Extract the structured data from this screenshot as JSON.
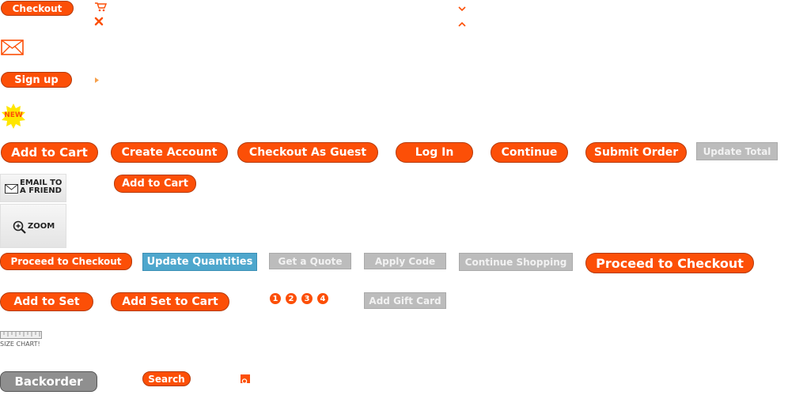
{
  "buttons": {
    "checkout_small": "Checkout",
    "sign_up": "Sign up",
    "add_to_cart": "Add to Cart",
    "create_account": "Create Account",
    "checkout_as_guest": "Checkout As Guest",
    "log_in": "Log In",
    "continue": "Continue",
    "submit_order": "Submit Order",
    "update_total": "Update Total",
    "add_to_cart_small": "Add to Cart",
    "proceed_to_checkout_small": "Proceed to Checkout",
    "update_quantities": "Update Quantities",
    "get_a_quote": "Get a Quote",
    "apply_code": "Apply Code",
    "continue_shopping": "Continue Shopping",
    "proceed_to_checkout_large": "Proceed to Checkout",
    "add_to_set": "Add to Set",
    "add_set_to_cart": "Add Set to Cart",
    "add_gift_card": "Add Gift Card",
    "backorder": "Backorder",
    "search": "Search"
  },
  "badges": {
    "new": "NEW"
  },
  "tiles": {
    "email_line1": "EMAIL TO",
    "email_line2": "A FRIEND",
    "zoom": "ZOOM"
  },
  "size_chart": "SIZE CHART!",
  "steps": [
    "1",
    "2",
    "3",
    "4"
  ],
  "icons": [
    "cart-icon",
    "close-icon",
    "chevron-down-icon",
    "chevron-up-icon",
    "envelope-icon",
    "arrow-right-icon",
    "magnifier-icon",
    "search-icon",
    "ruler-icon"
  ],
  "colors": {
    "accent": "#fc4f07",
    "gray_button": "#bcbcbc",
    "blue_button": "#4ea7cd",
    "dark_gray_button": "#8f8f8f"
  }
}
